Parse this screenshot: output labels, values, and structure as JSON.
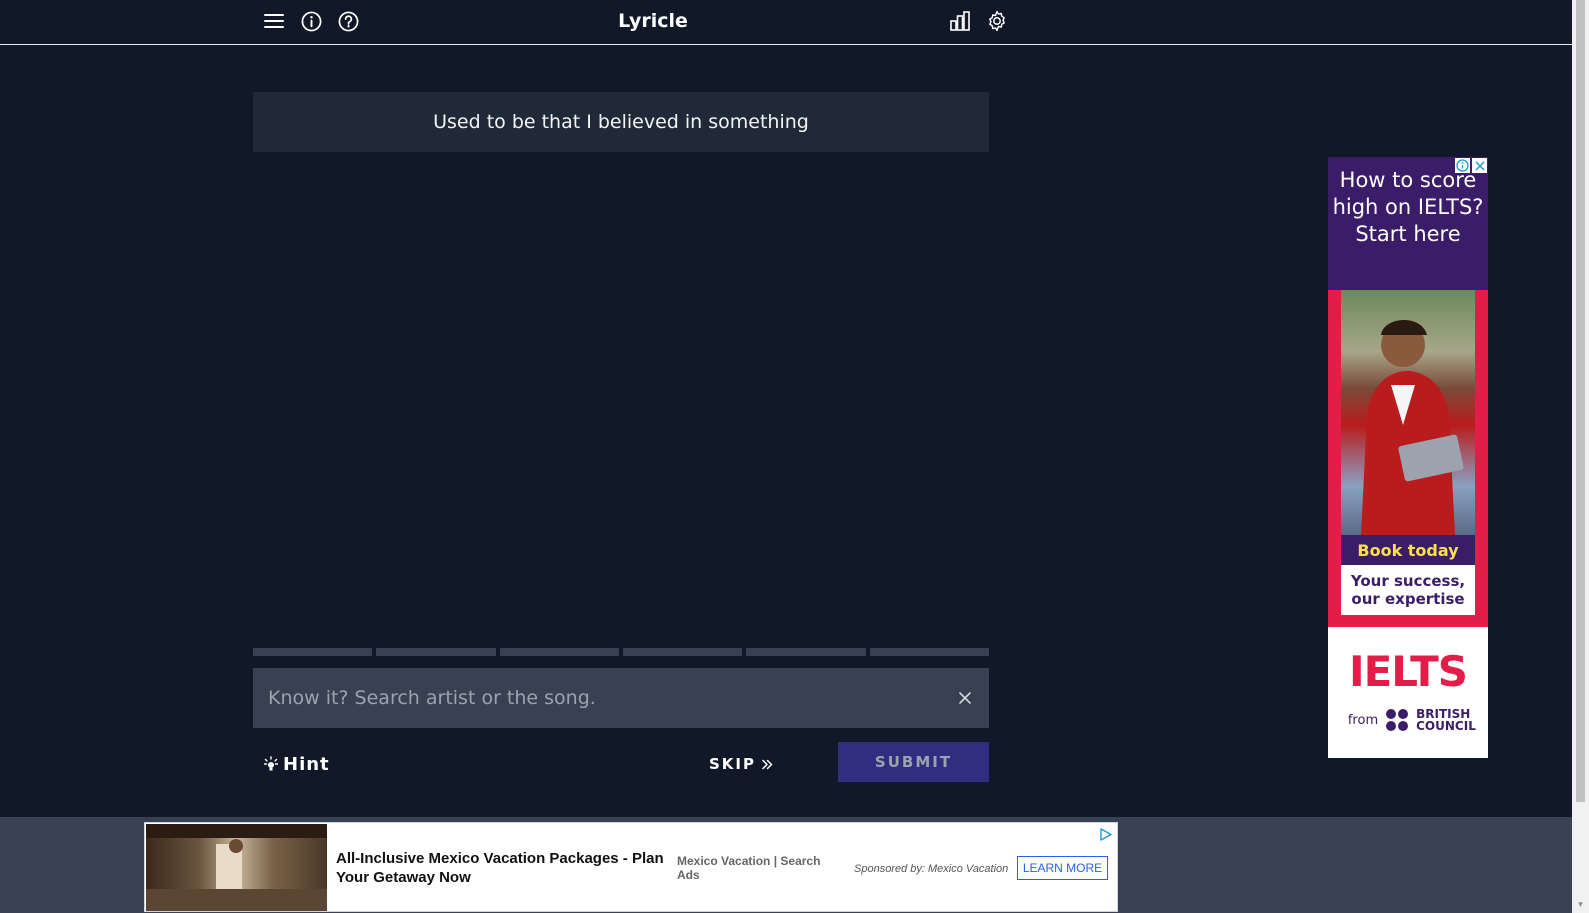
{
  "header": {
    "title": "Lyricle",
    "icons_left": [
      "menu-icon",
      "info-icon",
      "help-icon"
    ],
    "icons_right": [
      "stats-icon",
      "settings-icon"
    ]
  },
  "game": {
    "lyric_line": "Used to be that I believed in something",
    "progress_segments": 6,
    "search": {
      "placeholder": "Know it? Search artist or the song.",
      "value": ""
    },
    "hint_label": "Hint",
    "skip_label": "SKIP",
    "submit_label": "SUBMIT"
  },
  "side_ad": {
    "headline": "How to score high on IELTS? Start here",
    "cta": "Book today",
    "tagline": "Your success, our expertise",
    "logo": "IELTS",
    "from_label": "from",
    "partner": "BRITISH COUNCIL"
  },
  "bottom_ad": {
    "title": "All-Inclusive Mexico Vacation Packages - Plan Your Getaway Now",
    "source": "Mexico Vacation | Search Ads",
    "sponsor": "Sponsored by: Mexico Vacation",
    "cta": "LEARN MORE"
  },
  "colors": {
    "background": "#111827",
    "panel": "#1f2937",
    "input": "#374151",
    "submit": "#312e81",
    "ad_purple": "#3b1c68",
    "ad_red": "#e11d48"
  }
}
